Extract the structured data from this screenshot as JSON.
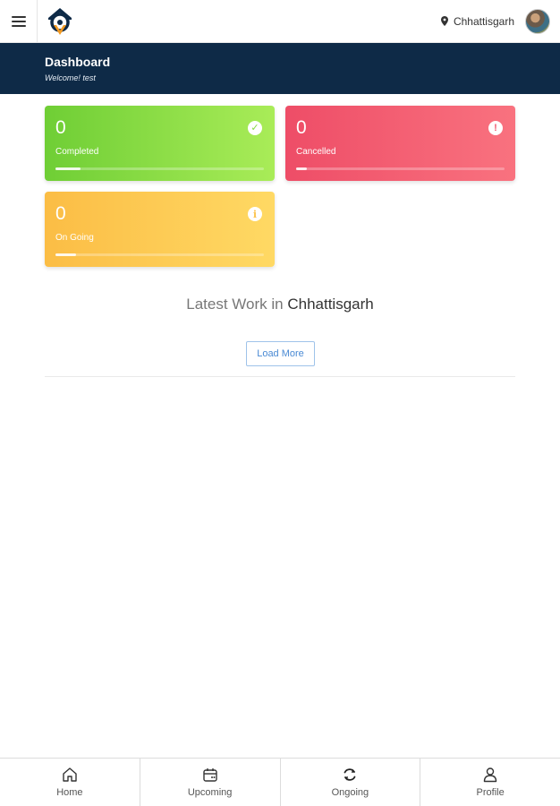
{
  "topbar": {
    "location": "Chhattisgarh"
  },
  "header": {
    "title": "Dashboard",
    "welcome": "Welcome! test"
  },
  "stats": [
    {
      "count": "0",
      "label": "Completed",
      "icon": "check-icon",
      "color": "#87da42",
      "progress": 0.12
    },
    {
      "count": "0",
      "label": "Cancelled",
      "icon": "exclamation-icon",
      "color": "#f15c72",
      "progress": 0.05
    },
    {
      "count": "0",
      "label": "On Going",
      "icon": "info-icon",
      "color": "#fcc44e",
      "progress": 0.1
    }
  ],
  "latest": {
    "prefix": "Latest Work in",
    "region": "Chhattisgarh",
    "load_more": "Load More"
  },
  "bottom_nav": [
    {
      "label": "Home",
      "icon": "home-icon"
    },
    {
      "label": "Upcoming",
      "icon": "calendar-icon"
    },
    {
      "label": "Ongoing",
      "icon": "refresh-icon"
    },
    {
      "label": "Profile",
      "icon": "user-icon"
    }
  ]
}
